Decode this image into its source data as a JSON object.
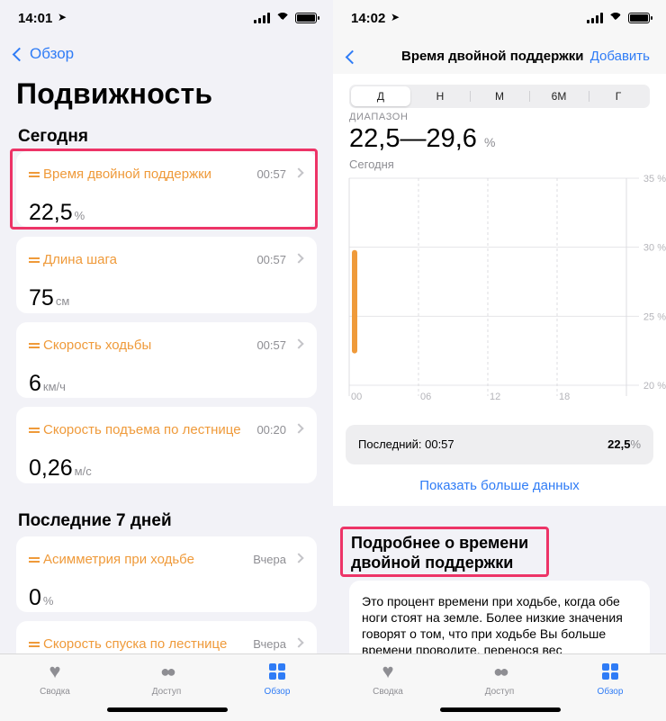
{
  "colors": {
    "accent": "#2f7cf6",
    "mobility": "#ef9a3a",
    "highlight": "#ed3467",
    "secondary_text": "#8e8e93"
  },
  "left": {
    "status_time": "14:01",
    "back_label": "Обзор",
    "title": "Подвижность",
    "today_section": "Сегодня",
    "week_section": "Последние 7 дней",
    "cards": [
      {
        "title": "Время двойной поддержки",
        "time": "00:57",
        "value": "22,5",
        "unit": "%"
      },
      {
        "title": "Длина шага",
        "time": "00:57",
        "value": "75",
        "unit": "см"
      },
      {
        "title": "Скорость ходьбы",
        "time": "00:57",
        "value": "6",
        "unit": "км/ч"
      },
      {
        "title": "Скорость подъема по лестнице",
        "time": "00:20",
        "value": "0,26",
        "unit": "м/с"
      },
      {
        "title": "Асимметрия при ходьбе",
        "time": "Вчера",
        "value": "0",
        "unit": "%"
      },
      {
        "title": "Скорость спуска по лестнице",
        "time": "Вчера",
        "value": "",
        "unit": ""
      }
    ]
  },
  "tabbar": {
    "summary": "Сводка",
    "sharing": "Доступ",
    "browse": "Обзор"
  },
  "right": {
    "status_time": "14:02",
    "nav_title": "Время двойной поддержки",
    "add_label": "Добавить",
    "segments": [
      "Д",
      "Н",
      "М",
      "6М",
      "Г"
    ],
    "selected_segment": "Д",
    "range_label": "ДИАПАЗОН",
    "range_value": "22,5—29,6",
    "range_unit": "%",
    "today_label": "Сегодня",
    "last_label": "Последний: 00:57",
    "last_value": "22,5",
    "last_unit": "%",
    "more_link": "Показать больше данных",
    "about_title_line1": "Подробнее о времени",
    "about_title_line2": "двойной поддержки",
    "about_text": "Это процент времени при ходьбе, когда обе ноги стоят на земле. Более низкие значения говорят о том, что при ходьбе Вы больше времени проводите, перенося вес"
  },
  "chart_data": {
    "type": "bar",
    "x_ticks": [
      "00",
      "06",
      "12",
      "18"
    ],
    "y_ticks": [
      "35 %",
      "30 %",
      "25 %",
      "20 %"
    ],
    "ylim": [
      20,
      35
    ],
    "xlim": [
      0,
      24
    ],
    "series": [
      {
        "values": [
          {
            "x": 0,
            "low": 22.5,
            "high": 29.6
          }
        ]
      }
    ]
  }
}
